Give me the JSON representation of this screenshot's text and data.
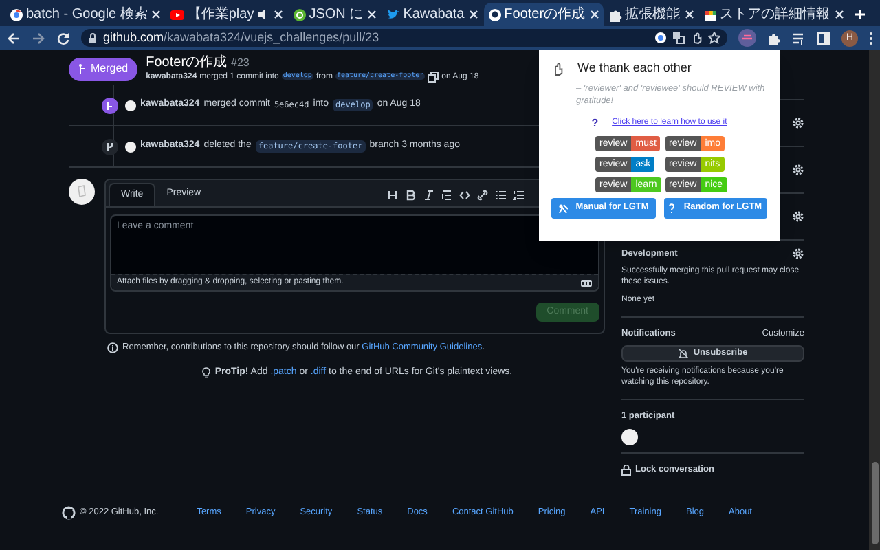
{
  "browser": {
    "tabs": [
      {
        "title": "batch - Google 検索",
        "kind": "google",
        "selected": false,
        "audio": false
      },
      {
        "title": "【作業play",
        "kind": "youtube",
        "selected": false,
        "audio": true
      },
      {
        "title": "JSON に",
        "kind": "green",
        "selected": false,
        "audio": false
      },
      {
        "title": "Kawabata",
        "kind": "twitter",
        "selected": false,
        "audio": false
      },
      {
        "title": "Footerの作成",
        "kind": "github",
        "selected": true,
        "audio": false
      },
      {
        "title": "拡張機能",
        "kind": "puzzle",
        "selected": false,
        "audio": false
      },
      {
        "title": "ストアの詳細情報",
        "kind": "store",
        "selected": false,
        "audio": false
      }
    ],
    "url_host": "github.com",
    "url_path": "/kawabata324/vuejs_challenges/pull/23",
    "profile_initial": "H"
  },
  "pr": {
    "status": "Merged",
    "title": "Footerの作成",
    "number": "#23",
    "author": "kawabata324",
    "merged_text": "merged 1 commit into",
    "base": "develop",
    "from_text": "from",
    "head": "feature/create-footer",
    "date_text": "on Aug 18"
  },
  "timeline": [
    {
      "kind": "merged",
      "user": "kawabata324",
      "text": "merged commit",
      "sha": "5e6ec4d",
      "text2": "into",
      "branch": "develop",
      "text3": "on Aug 18"
    },
    {
      "kind": "deleted",
      "user": "kawabata324",
      "text": "deleted the",
      "branch": "feature/create-footer",
      "text3": "branch 3 months ago"
    }
  ],
  "comment_form": {
    "tabs": [
      {
        "label": "Write",
        "selected": true
      },
      {
        "label": "Preview",
        "selected": false
      }
    ],
    "placeholder": "Leave a comment",
    "attach_hint": "Attach files by dragging & dropping, selecting or pasting them.",
    "submit": "Comment",
    "submit_disabled": true
  },
  "guidelines": {
    "before": "Remember, contributions to this repository should follow our ",
    "link": "GitHub Community Guidelines",
    "after": "."
  },
  "protip": {
    "lead": "ProTip!",
    "t1": " Add ",
    "l1": ".patch",
    "t2": " or ",
    "l2": ".diff",
    "t3": " to the end of URLs for Git's plaintext views."
  },
  "sidebar": {
    "development": {
      "heading": "Development",
      "text": "Successfully merging this pull request may close these issues.",
      "none": "None yet"
    },
    "notifications": {
      "heading": "Notifications",
      "customize": "Customize",
      "button": "Unsubscribe",
      "text": "You're receiving notifications because you're watching this repository."
    },
    "participants": {
      "heading": "1 participant"
    },
    "lock": "Lock conversation"
  },
  "popup": {
    "title": "We thank each other",
    "subtitle": "– 'reviewer' and 'reviewee' should REVIEW with gratitude!",
    "help_mark": "?",
    "help_link": "Click here to learn how to use it",
    "badges": [
      {
        "left": "review",
        "right": "must",
        "color": "#e05d44"
      },
      {
        "left": "review",
        "right": "imo",
        "color": "#fe7d37"
      },
      {
        "left": "review",
        "right": "ask",
        "color": "#007ec6"
      },
      {
        "left": "review",
        "right": "nits",
        "color": "#97ca00"
      },
      {
        "left": "review",
        "right": "learn",
        "color": "#4dc820"
      },
      {
        "left": "review",
        "right": "nice",
        "color": "#44cc11"
      }
    ],
    "buttons": [
      {
        "label": "Manual for LGTM",
        "kind": "manual"
      },
      {
        "label": "Random for LGTM",
        "kind": "random"
      }
    ]
  },
  "footer": {
    "copyright": "© 2022 GitHub, Inc.",
    "links": [
      "Terms",
      "Privacy",
      "Security",
      "Status",
      "Docs",
      "Contact GitHub",
      "Pricing",
      "API",
      "Training",
      "Blog",
      "About"
    ]
  }
}
